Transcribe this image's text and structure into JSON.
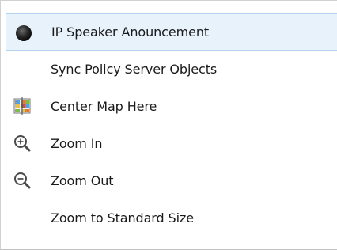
{
  "menu": {
    "items": [
      {
        "label": "IP Speaker Anouncement",
        "icon": "speaker-icon"
      },
      {
        "label": "Sync Policy Server Objects",
        "icon": ""
      },
      {
        "label": "Center Map Here",
        "icon": "map-icon"
      },
      {
        "label": "Zoom In",
        "icon": "zoom-in-icon"
      },
      {
        "label": "Zoom Out",
        "icon": "zoom-out-icon"
      },
      {
        "label": "Zoom to Standard Size",
        "icon": ""
      }
    ],
    "highlight_color": "#e8f2fb",
    "highlight_border_color": "#b5d3ef"
  }
}
